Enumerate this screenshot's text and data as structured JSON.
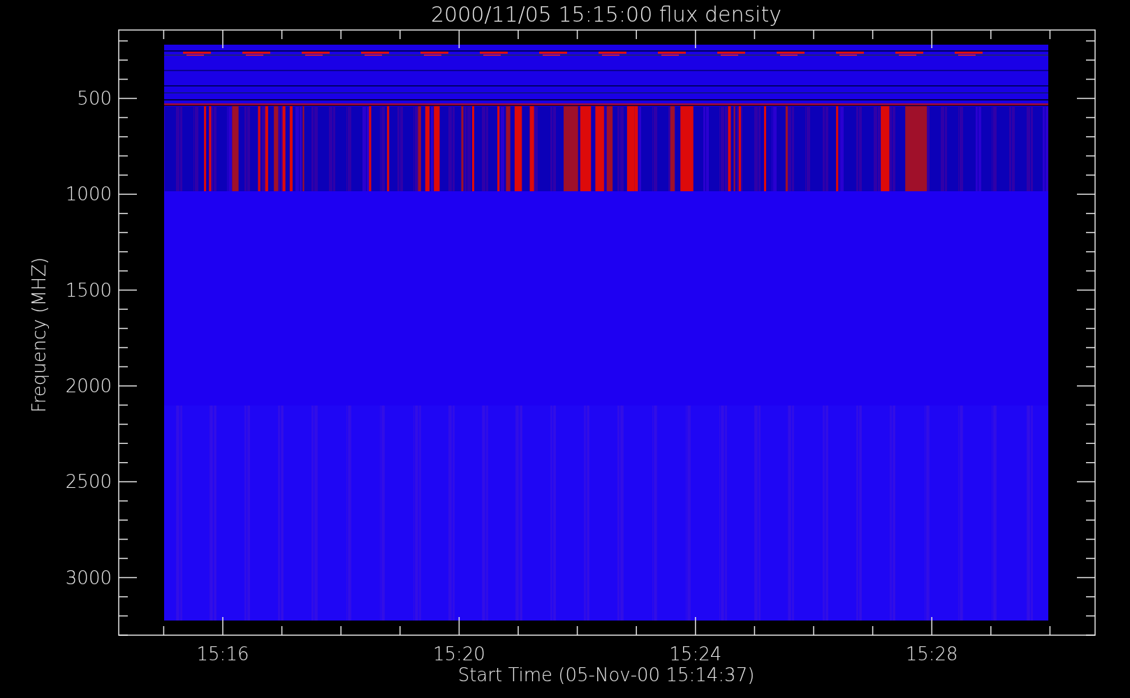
{
  "plot": {
    "title": "2000/11/05 15:15:00 flux density",
    "xlabel": "Start Time (05-Nov-00 15:14:37)",
    "ylabel": "Frequency (MHZ)",
    "x_tick_labels": [
      "15:16",
      "15:20",
      "15:24",
      "15:28"
    ],
    "y_tick_labels": [
      "500",
      "1000",
      "1500",
      "2000",
      "2500",
      "3000"
    ]
  }
}
